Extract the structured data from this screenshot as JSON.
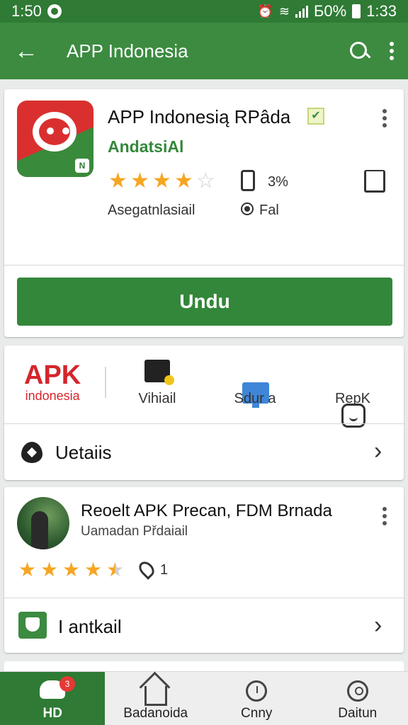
{
  "status_bar": {
    "time_left": "1:50",
    "battery": "Б0%",
    "time_right": "1:33"
  },
  "app_bar": {
    "back_icon": "arrow-left-icon",
    "title": "APP Indonesia",
    "search_icon": "search-icon",
    "menu_icon": "more-vert-icon"
  },
  "app_card": {
    "name": "APP Indonesią RPâda",
    "developer": "AndatsiAl",
    "rating_stars": 4,
    "rating_max": 5,
    "size_label": "3%",
    "category_label": "Asegatnlasiail",
    "option_label": "Fal",
    "install_button": "Undu",
    "verified_icon": "check-icon",
    "share_icon": "share-icon"
  },
  "feature_card": {
    "brand_big": "APK",
    "brand_small": "indonesia",
    "tabs": [
      {
        "label": "Vihiail",
        "icon": "document-icon"
      },
      {
        "label": "Sdur a",
        "icon": "monitor-icon"
      },
      {
        "label": "RepK",
        "icon": "face-icon"
      }
    ],
    "details_label": "Uetaiis"
  },
  "review_card": {
    "title": "Reoelt APK Precan, FDM Brnada",
    "subtitle": "Uamadan Přdaiail",
    "rating_stars": 4.5,
    "rating_max": 5,
    "location_count": "1",
    "link_label": "I antkail"
  },
  "bottom_nav": {
    "items": [
      {
        "label": "HD",
        "icon": "robot-icon",
        "badge": "3",
        "active": true
      },
      {
        "label": "Badanoida",
        "icon": "home-icon"
      },
      {
        "label": "Cnny",
        "icon": "clock-icon"
      },
      {
        "label": "Daitun",
        "icon": "person-icon"
      }
    ]
  },
  "colors": {
    "primary": "#3c8b40",
    "primary_dark": "#2f7a34",
    "brand_red": "#d4262b",
    "star": "#f5a623"
  }
}
